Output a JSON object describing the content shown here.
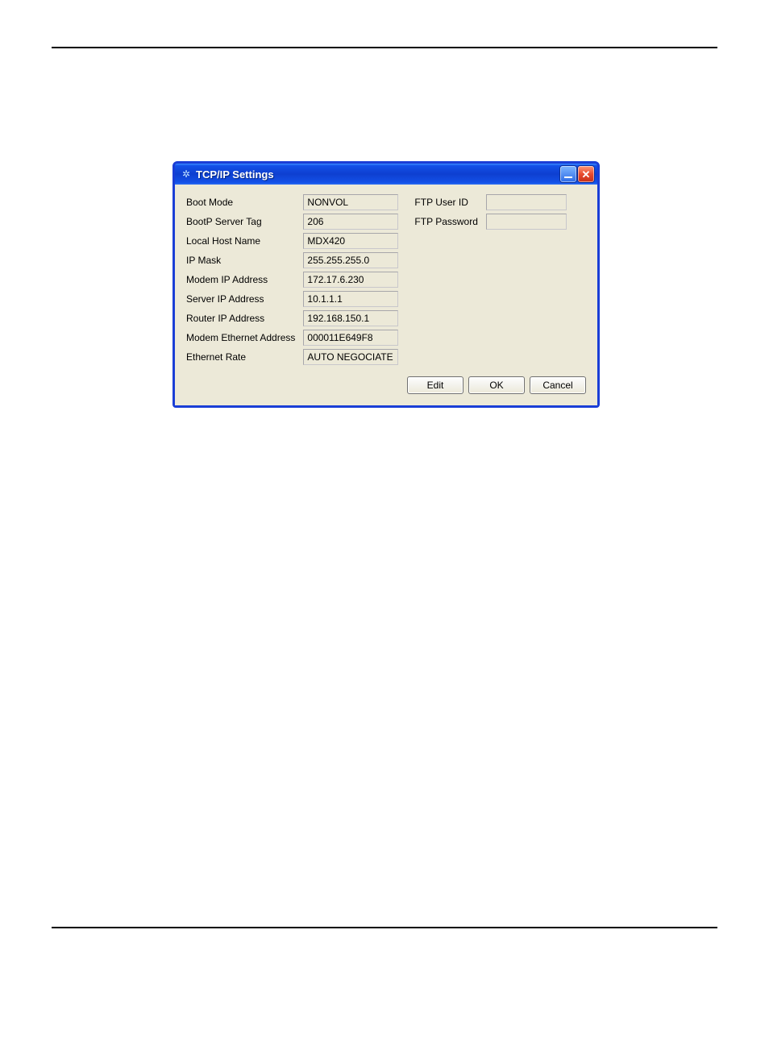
{
  "window": {
    "title": "TCP/IP Settings"
  },
  "left_fields": [
    {
      "label": "Boot Mode",
      "value": "NONVOL"
    },
    {
      "label": "BootP Server Tag",
      "value": "206"
    },
    {
      "label": "Local Host Name",
      "value": "MDX420"
    },
    {
      "label": "IP Mask",
      "value": "255.255.255.0"
    },
    {
      "label": "Modem IP Address",
      "value": "172.17.6.230"
    },
    {
      "label": "Server IP Address",
      "value": "10.1.1.1"
    },
    {
      "label": "Router IP Address",
      "value": "192.168.150.1"
    },
    {
      "label": "Modem Ethernet Address",
      "value": "000011E649F8"
    },
    {
      "label": "Ethernet Rate",
      "value": "AUTO NEGOCIATE"
    }
  ],
  "right_fields": [
    {
      "label": "FTP User ID",
      "value": ""
    },
    {
      "label": "FTP Password",
      "value": ""
    }
  ],
  "buttons": {
    "edit": "Edit",
    "ok": "OK",
    "cancel": "Cancel"
  }
}
